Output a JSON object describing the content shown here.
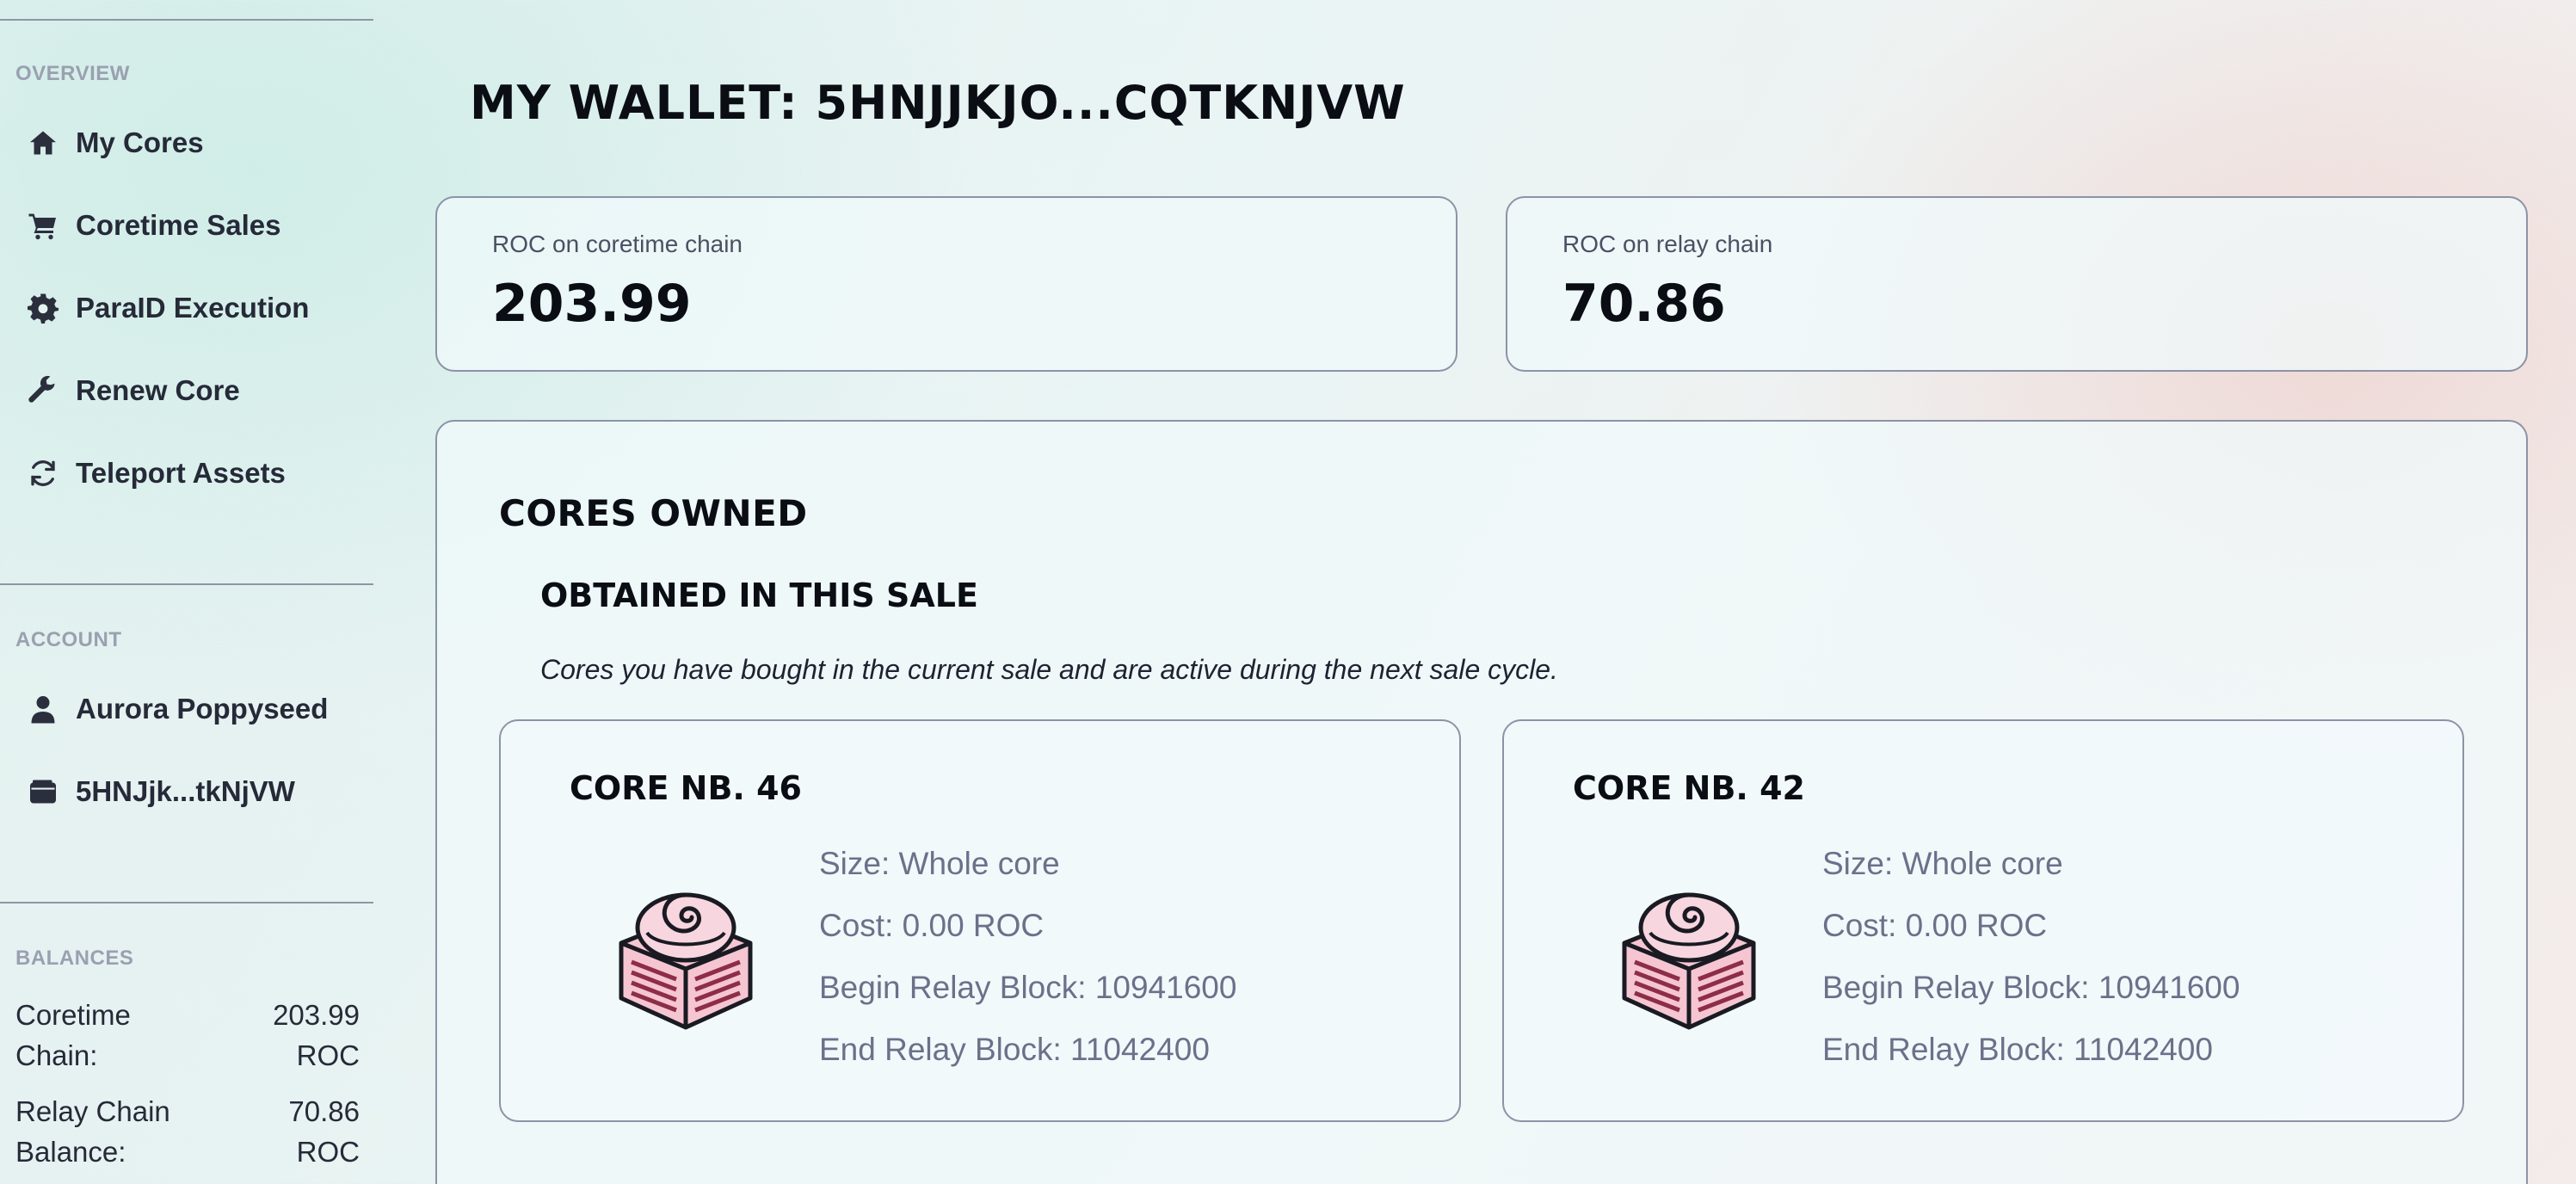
{
  "sidebar": {
    "overview_label": "OVERVIEW",
    "nav": [
      {
        "label": "My Cores",
        "icon": "home-icon"
      },
      {
        "label": "Coretime Sales",
        "icon": "cart-icon"
      },
      {
        "label": "ParaID Execution",
        "icon": "gear-icon"
      },
      {
        "label": "Renew Core",
        "icon": "wrench-icon"
      },
      {
        "label": "Teleport Assets",
        "icon": "refresh-icon"
      }
    ],
    "account_label": "ACCOUNT",
    "account": [
      {
        "label": "Aurora Poppyseed",
        "icon": "user-icon"
      },
      {
        "label": "5HNJjk...tkNjVW",
        "icon": "wallet-icon"
      }
    ],
    "balances_label": "BALANCES",
    "balances": [
      {
        "label_line1": "Coretime",
        "label_line2": "Chain:",
        "value_line1": "203.99",
        "value_line2": "ROC"
      },
      {
        "label_line1": "Relay Chain",
        "label_line2": "Balance:",
        "value_line1": "70.86",
        "value_line2": "ROC"
      }
    ]
  },
  "main": {
    "title": "MY WALLET: 5HNJJKJO...CQTKNJVW",
    "stats": [
      {
        "label": "ROC on coretime chain",
        "value": "203.99"
      },
      {
        "label": "ROC on relay chain",
        "value": "70.86"
      }
    ],
    "cores_owned_title": "CORES OWNED",
    "sale_title": "OBTAINED IN THIS SALE",
    "sale_description": "Cores you have bought in the current sale and are active during the next sale cycle.",
    "cores": [
      {
        "title": "CORE NB. 46",
        "size": "Size: Whole core",
        "cost": "Cost: 0.00 ROC",
        "begin": "Begin Relay Block: 10941600",
        "end": "End Relay Block: 11042400"
      },
      {
        "title": "CORE NB. 42",
        "size": "Size: Whole core",
        "cost": "Cost: 0.00 ROC",
        "begin": "Begin Relay Block: 10941600",
        "end": "End Relay Block: 11042400"
      }
    ]
  },
  "colors": {
    "accent_pink": "#f4b7c6",
    "text_dark": "#0b0d14",
    "muted": "#6b7189",
    "border": "#8c93a6"
  }
}
